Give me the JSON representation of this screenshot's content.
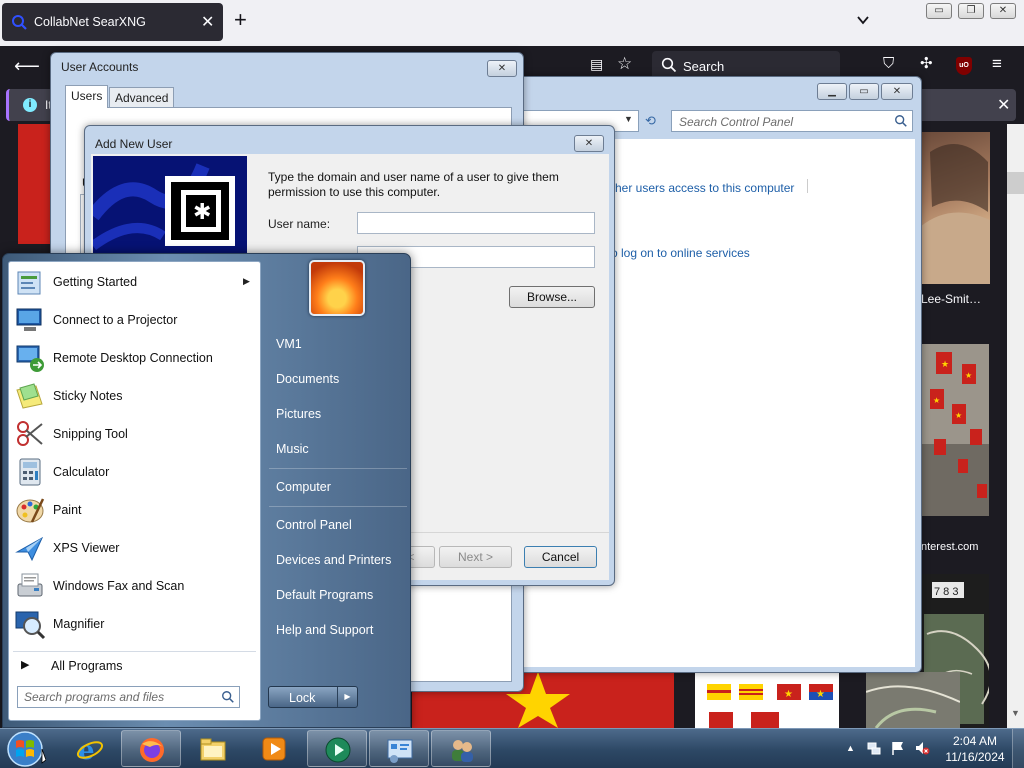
{
  "browser": {
    "tab_title": "CollabNet SearXNG",
    "search_placeholder": "Search",
    "notice_text": "It"
  },
  "page": {
    "caption_1": "Lee-Smit…",
    "caption_2": "nterest.com",
    "tile_numbers": "7 8 3"
  },
  "control_panel": {
    "search_placeholder": "Search Control Panel",
    "link_1": "other users access to this computer",
    "link_2": "o log on to online services"
  },
  "user_accounts": {
    "title": "User Accounts",
    "tabs": [
      "Users",
      "Advanced"
    ],
    "stub_label": "U"
  },
  "add_new_user": {
    "title": "Add New User",
    "prompt": "Type the domain and user name of a user to give them permission to use this computer.",
    "user_name_label": "User name:",
    "user_name_value": "",
    "browse_label": "Browse...",
    "back_label": "<",
    "next_label": "Next >",
    "cancel_label": "Cancel"
  },
  "start_menu": {
    "programs": [
      {
        "label": "Getting Started",
        "icon": "getting-started-icon"
      },
      {
        "label": "Connect to a Projector",
        "icon": "projector-icon"
      },
      {
        "label": "Remote Desktop Connection",
        "icon": "remote-desktop-icon"
      },
      {
        "label": "Sticky Notes",
        "icon": "sticky-notes-icon"
      },
      {
        "label": "Snipping Tool",
        "icon": "snipping-tool-icon"
      },
      {
        "label": "Calculator",
        "icon": "calculator-icon"
      },
      {
        "label": "Paint",
        "icon": "paint-icon"
      },
      {
        "label": "XPS Viewer",
        "icon": "xps-viewer-icon"
      },
      {
        "label": "Windows Fax and Scan",
        "icon": "fax-scan-icon"
      },
      {
        "label": "Magnifier",
        "icon": "magnifier-icon"
      }
    ],
    "all_programs": "All Programs",
    "search_placeholder": "Search programs and files",
    "right_items": [
      "VM1",
      "Documents",
      "Pictures",
      "Music",
      "Computer",
      "Control Panel",
      "Devices and Printers",
      "Default Programs",
      "Help and Support"
    ],
    "lock_label": "Lock"
  },
  "taskbar": {
    "time": "2:04 AM",
    "date": "11/16/2024",
    "pinned": [
      "internet-explorer-icon",
      "firefox-icon",
      "explorer-icon",
      "media-player-icon",
      "media-center-icon",
      "control-panel-icon",
      "user-accounts-icon"
    ]
  },
  "colors": {
    "firefox_dark": "#1c1b22",
    "win7_title": "#c3d5eb",
    "link_blue": "#1e5fa8",
    "flag_red": "#c9221c",
    "star_yellow": "#ffd400"
  }
}
